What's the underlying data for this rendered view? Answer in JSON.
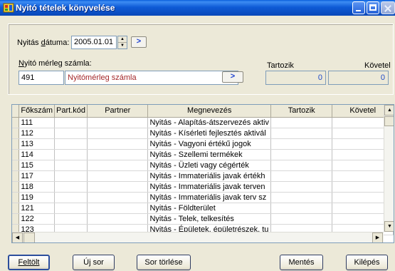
{
  "window": {
    "title": "Nyitó tételek könyvelése",
    "accent": "#0a5fdc"
  },
  "header": {
    "date_label_pre": "Nyitás ",
    "date_label_u": "d",
    "date_label_post": "átuma:",
    "date_value": "2005.01.01",
    "date_go_label": ">",
    "account_label_u": "N",
    "account_label_post": "yitó mérleg számla:",
    "account_code": "491",
    "account_name": "Nyitómérleg számla",
    "account_go_label": ">",
    "debit_label": "Tartozik",
    "credit_label": "Követel",
    "debit_value": "0",
    "credit_value": "0"
  },
  "table": {
    "columns": [
      "Főkszám",
      "Part.kód",
      "Partner",
      "Megnevezés",
      "Tartozik",
      "Követel"
    ],
    "rows": [
      [
        "111",
        "",
        "",
        "Nyitás - Alapítás-átszervezés aktiv",
        "",
        ""
      ],
      [
        "112",
        "",
        "",
        "Nyitás - Kísérleti fejlesztés aktivál",
        "",
        ""
      ],
      [
        "113",
        "",
        "",
        "Nyitás - Vagyoni értékű jogok",
        "",
        ""
      ],
      [
        "114",
        "",
        "",
        "Nyitás - Szellemi termékek",
        "",
        ""
      ],
      [
        "115",
        "",
        "",
        "Nyitás - Üzleti vagy cégérték",
        "",
        ""
      ],
      [
        "117",
        "",
        "",
        "Nyitás - Immateriális javak értékh",
        "",
        ""
      ],
      [
        "118",
        "",
        "",
        "Nyitás - Immateriális javak terven",
        "",
        ""
      ],
      [
        "119",
        "",
        "",
        "Nyitás - Immateriális javak terv sz",
        "",
        ""
      ],
      [
        "121",
        "",
        "",
        "Nyitás - Földterület",
        "",
        ""
      ],
      [
        "122",
        "",
        "",
        "Nyitás - Telek, telkesítés",
        "",
        ""
      ],
      [
        "123",
        "",
        "",
        "Nyitás - Épületek, épületrészek, tu",
        "",
        ""
      ]
    ]
  },
  "buttons": {
    "fill": "Feltölt",
    "fill_u": "F",
    "new_row": "Új sor",
    "new_row_u": "Ú",
    "delete_row": "Sor törlése",
    "save": "Mentés",
    "exit": "Kilépés"
  }
}
